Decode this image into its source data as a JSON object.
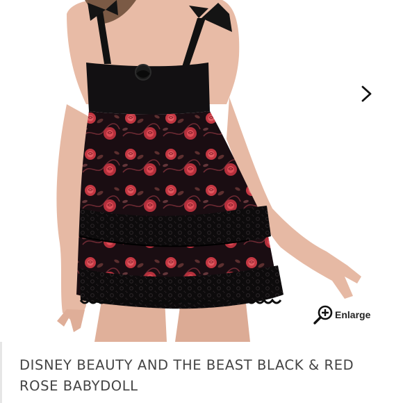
{
  "listing": {
    "image_alt": "Black and red rose print babydoll with lace ruffle tiers",
    "next_icon": "chevron-right-icon",
    "enlarge_icon": "zoom-in-icon",
    "enlarge_label": "Enlarge",
    "title": "DISNEY BEAUTY AND THE BEAST BLACK & RED ROSE BABYDOLL"
  },
  "colors": {
    "dress_black": "#151013",
    "rose_red": "#d8424a",
    "skin": "#e3b49e",
    "title_text": "#444444"
  }
}
